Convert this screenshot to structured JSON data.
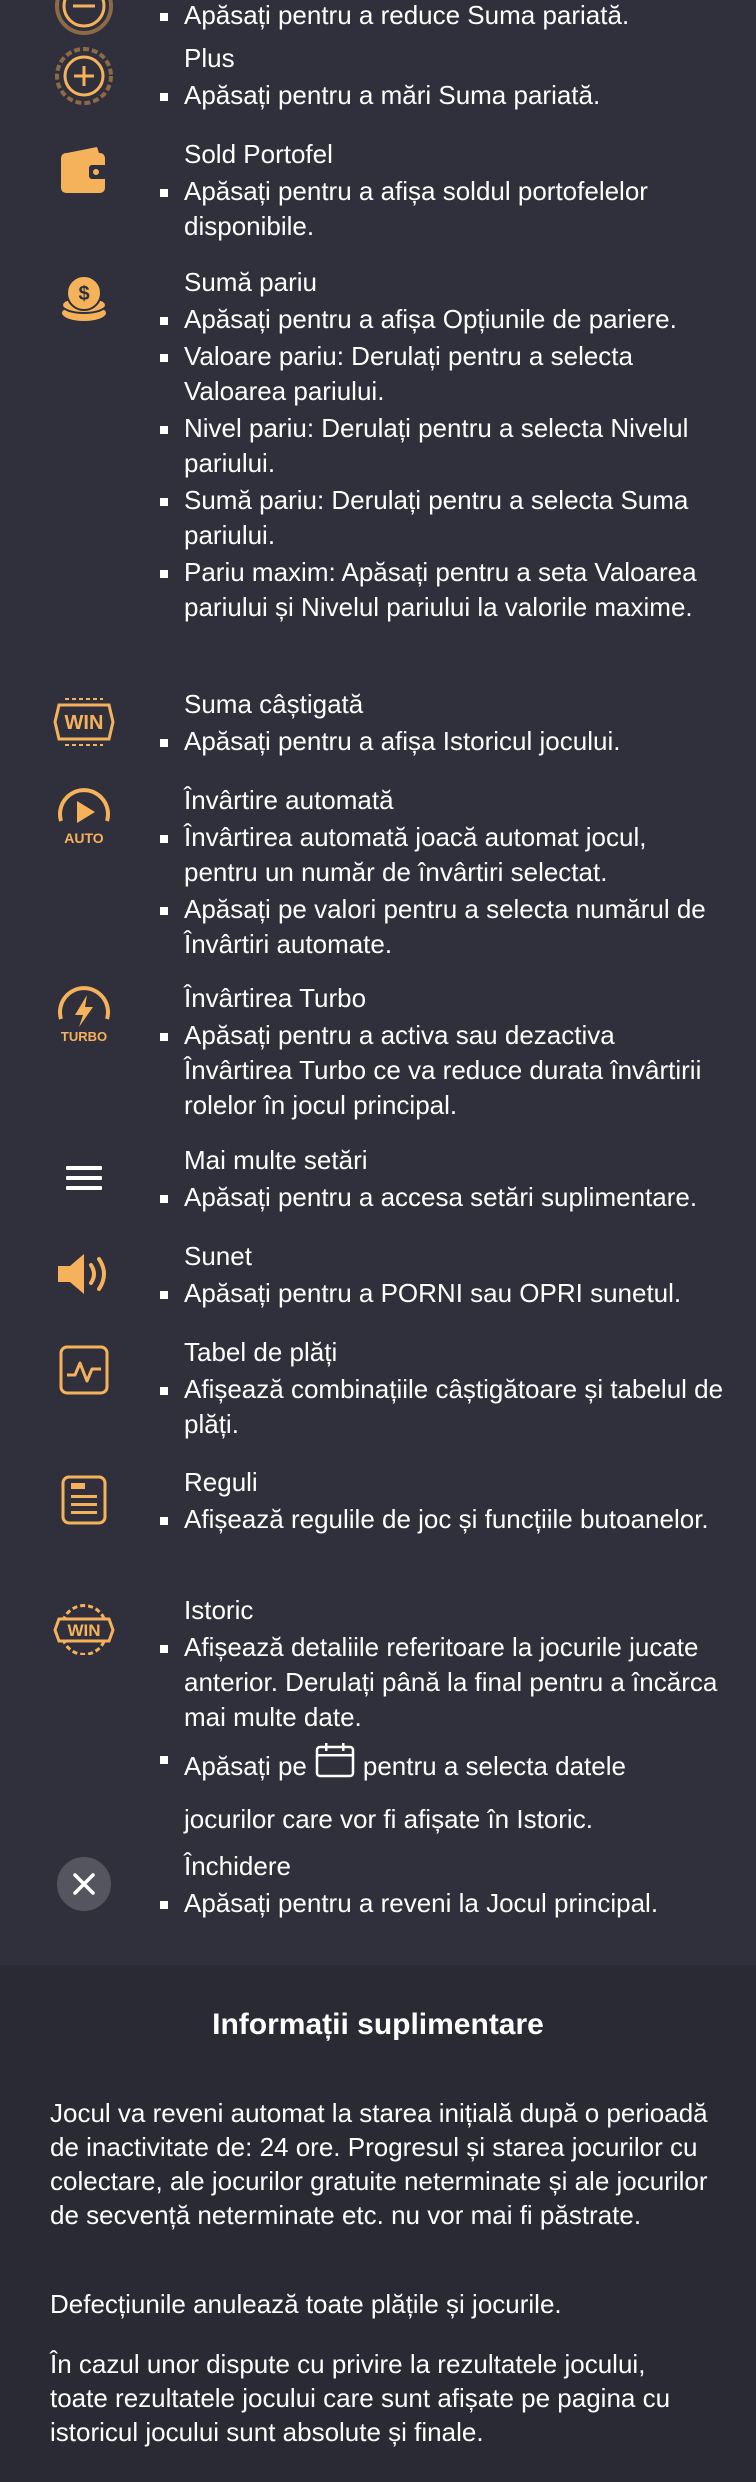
{
  "rules": [
    {
      "icon": "minus-icon",
      "title": "",
      "bullets": [
        "Apăsați pentru a reduce Suma pariată."
      ]
    },
    {
      "icon": "plus-icon",
      "title": "Plus",
      "bullets": [
        "Apăsați pentru a mări Suma pariată."
      ]
    },
    {
      "icon": "wallet-icon",
      "title": "Sold Portofel",
      "bullets": [
        "Apăsați pentru a afișa soldul portofelelor disponibile."
      ]
    },
    {
      "icon": "coins-icon",
      "title": "Sumă pariu",
      "bullets": [
        "Apăsați pentru a afișa Opțiunile de pariere.",
        "Valoare pariu: Derulați pentru a selecta Valoarea pariului.",
        "Nivel pariu: Derulați pentru a selecta Nivelul pariului.",
        "Sumă pariu: Derulați pentru a selecta Suma pariului.",
        "Pariu maxim: Apăsați pentru a seta Valoarea pariului și Nivelul pariului la valorile maxime."
      ]
    },
    {
      "icon": "win-badge-icon",
      "icon_text": "WIN",
      "title": "Suma câștigată",
      "bullets": [
        "Apăsați pentru a afișa Istoricul jocului."
      ]
    },
    {
      "icon": "auto-spin-icon",
      "icon_text": "AUTO",
      "title": "Învârtire automată",
      "bullets": [
        "Învârtirea automată joacă automat jocul, pentru un număr de învârtiri selectat.",
        "Apăsați pe valori pentru a selecta numărul de Învârtiri automate."
      ]
    },
    {
      "icon": "turbo-icon",
      "icon_text": "TURBO",
      "title": "Învârtirea Turbo",
      "bullets": [
        "Apăsați pentru a activa sau dezactiva Învârtirea Turbo ce va reduce durata învârtirii rolelor în jocul principal."
      ]
    },
    {
      "icon": "menu-icon",
      "title": "Mai multe setări",
      "bullets": [
        "Apăsați pentru a accesa setări suplimentare."
      ]
    },
    {
      "icon": "speaker-icon",
      "title": "Sunet",
      "bullets": [
        "Apăsați pentru a PORNI sau OPRI sunetul."
      ]
    },
    {
      "icon": "paytable-icon",
      "title": "Tabel de plăți",
      "bullets": [
        "Afișează combinațiile câștigătoare și tabelul de plăți."
      ]
    },
    {
      "icon": "rules-document-icon",
      "title": "Reguli",
      "bullets": [
        "Afișează regulile de joc și funcțiile butoanelor."
      ]
    },
    {
      "icon": "history-win-icon",
      "icon_text": "WIN",
      "title": "Istoric",
      "bullets": [
        "Afișează detaliile referitoare la jocurile jucate anterior. Derulați până la final pentru a încărca mai multe date."
      ],
      "calendar_before": "Apăsați pe",
      "calendar_after": "pentru a selecta datele",
      "calendar_line2": "jocurilor care vor fi afișate în Istoric."
    },
    {
      "icon": "close-icon",
      "title": "Închidere",
      "bullets": [
        "Apăsați pentru a reveni la Jocul principal."
      ]
    }
  ],
  "info": {
    "title": "Informații suplimentare",
    "paragraphs": [
      "Jocul va reveni automat la starea inițială după o perioadă de inactivitate de: 24 ore. Progresul și starea jocurilor cu colectare, ale jocurilor gratuite neterminate și ale jocurilor de secvență neterminate etc. nu vor mai fi păstrate.",
      "Defecțiunile anulează toate plățile și jocurile.",
      "În cazul unor dispute cu privire la rezultatele jocului, toate rezultatele jocului care sunt afișate pe pagina cu istoricul jocului sunt absolute și finale."
    ]
  },
  "colors": {
    "background": "#30303c",
    "info_background": "#2a2a35",
    "icon_gold": "#f6b25a",
    "close_circle": "#55555f"
  }
}
